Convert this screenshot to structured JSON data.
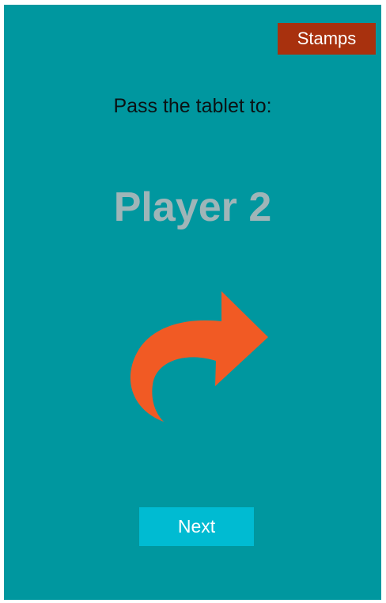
{
  "header": {
    "stamps_label": "Stamps"
  },
  "main": {
    "prompt": "Pass the tablet to:",
    "player_name": "Player 2",
    "arrow_icon": "curved-arrow-right-icon"
  },
  "footer": {
    "next_label": "Next"
  },
  "colors": {
    "background": "#00979f",
    "stamps_button": "#a8310e",
    "arrow": "#f15a24",
    "player_name": "#9fb5b8",
    "next_button": "#00bbd2"
  }
}
